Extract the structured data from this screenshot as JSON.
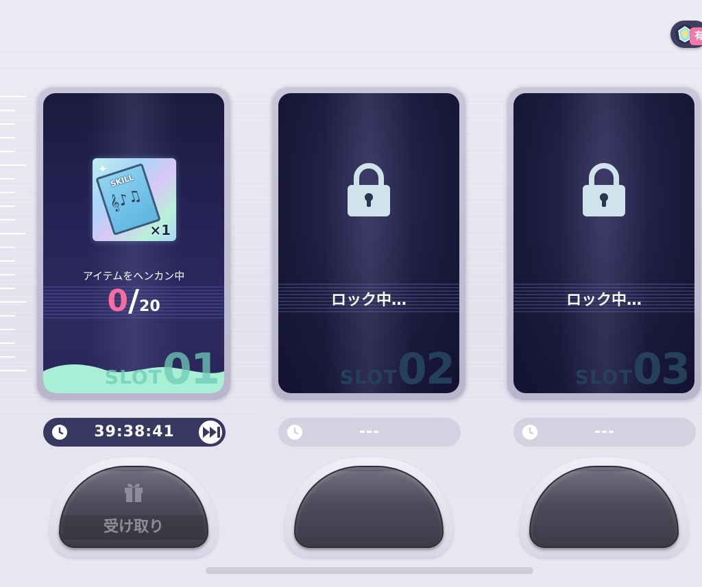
{
  "header": {
    "gem_badge_label": "有",
    "gem_icon": "rainbow-gem-icon"
  },
  "slots": [
    {
      "label_word": "SLOT",
      "label_num": "01",
      "state": "active",
      "item": {
        "title": "SKILL",
        "qty": "×1",
        "icon": "skill-book-icon"
      },
      "status_text": "アイテムをヘンカン中",
      "count_current": "0",
      "count_sep": "/",
      "count_total": "20",
      "timer": "39:38:41",
      "button_label": "受け取り"
    },
    {
      "label_word": "SLOT",
      "label_num": "02",
      "state": "locked",
      "lock_text": "ロック中…",
      "timer": "---"
    },
    {
      "label_word": "SLOT",
      "label_num": "03",
      "state": "locked",
      "lock_text": "ロック中…",
      "timer": "---"
    }
  ],
  "colors": {
    "accent_pink": "#f46f9f",
    "wave_mint": "#a9efd6",
    "panel_dark": "#1c1a3d",
    "timer_active": "#3a3860"
  }
}
